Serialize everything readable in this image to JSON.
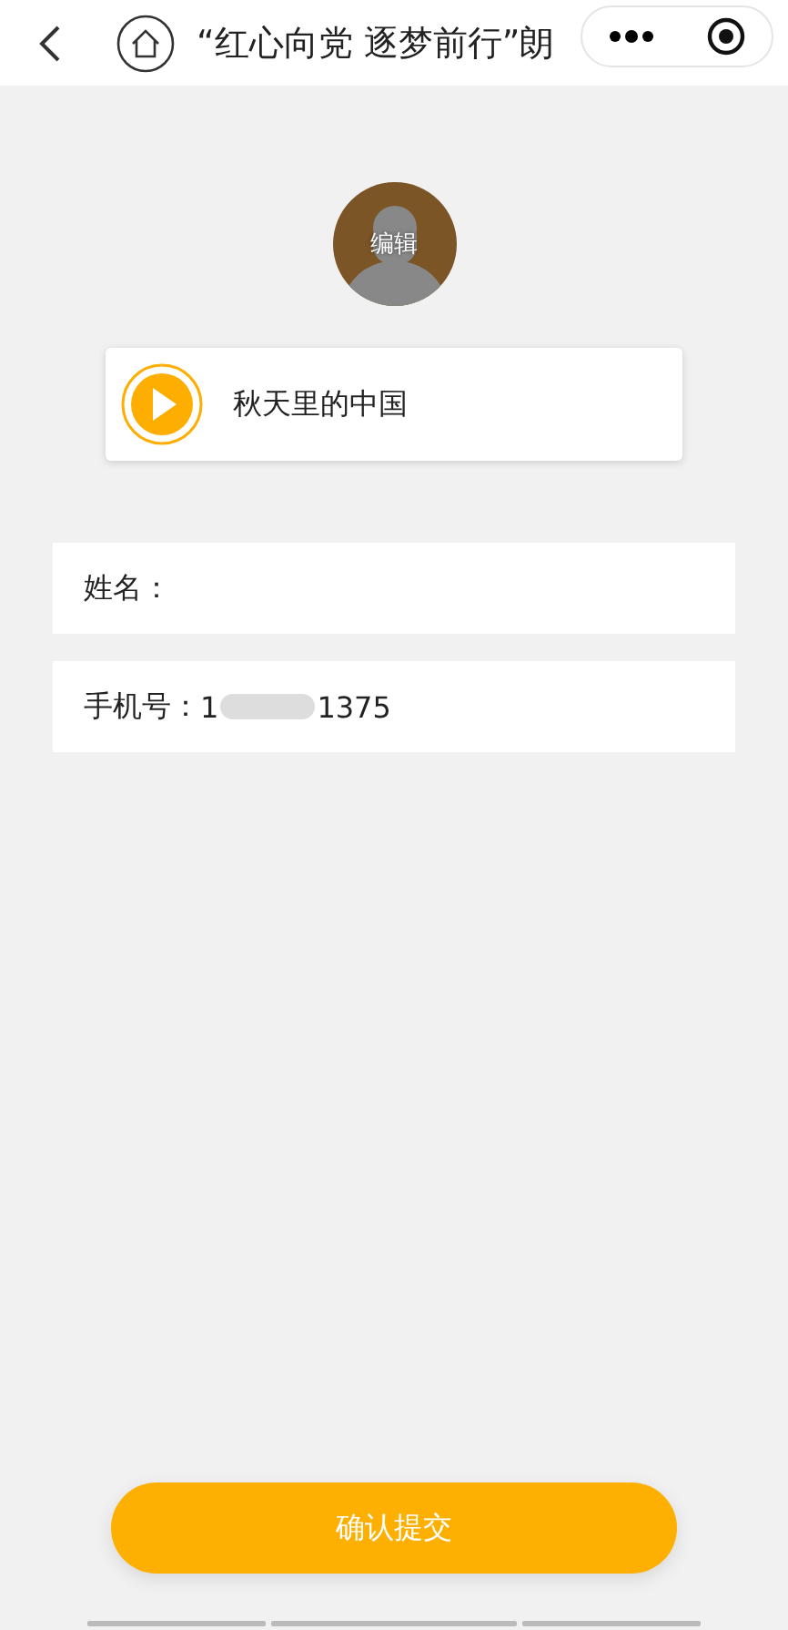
{
  "nav": {
    "title": "“红心向党 逐梦前行”朗"
  },
  "avatar": {
    "label": "编辑"
  },
  "track": {
    "title": "秋天里的中国"
  },
  "fields": [
    {
      "label": "姓名："
    },
    {
      "label": "手机号：",
      "value": "1",
      "value_end": "1375",
      "redacted": true
    }
  ],
  "submit": {
    "label": "确认提交"
  }
}
